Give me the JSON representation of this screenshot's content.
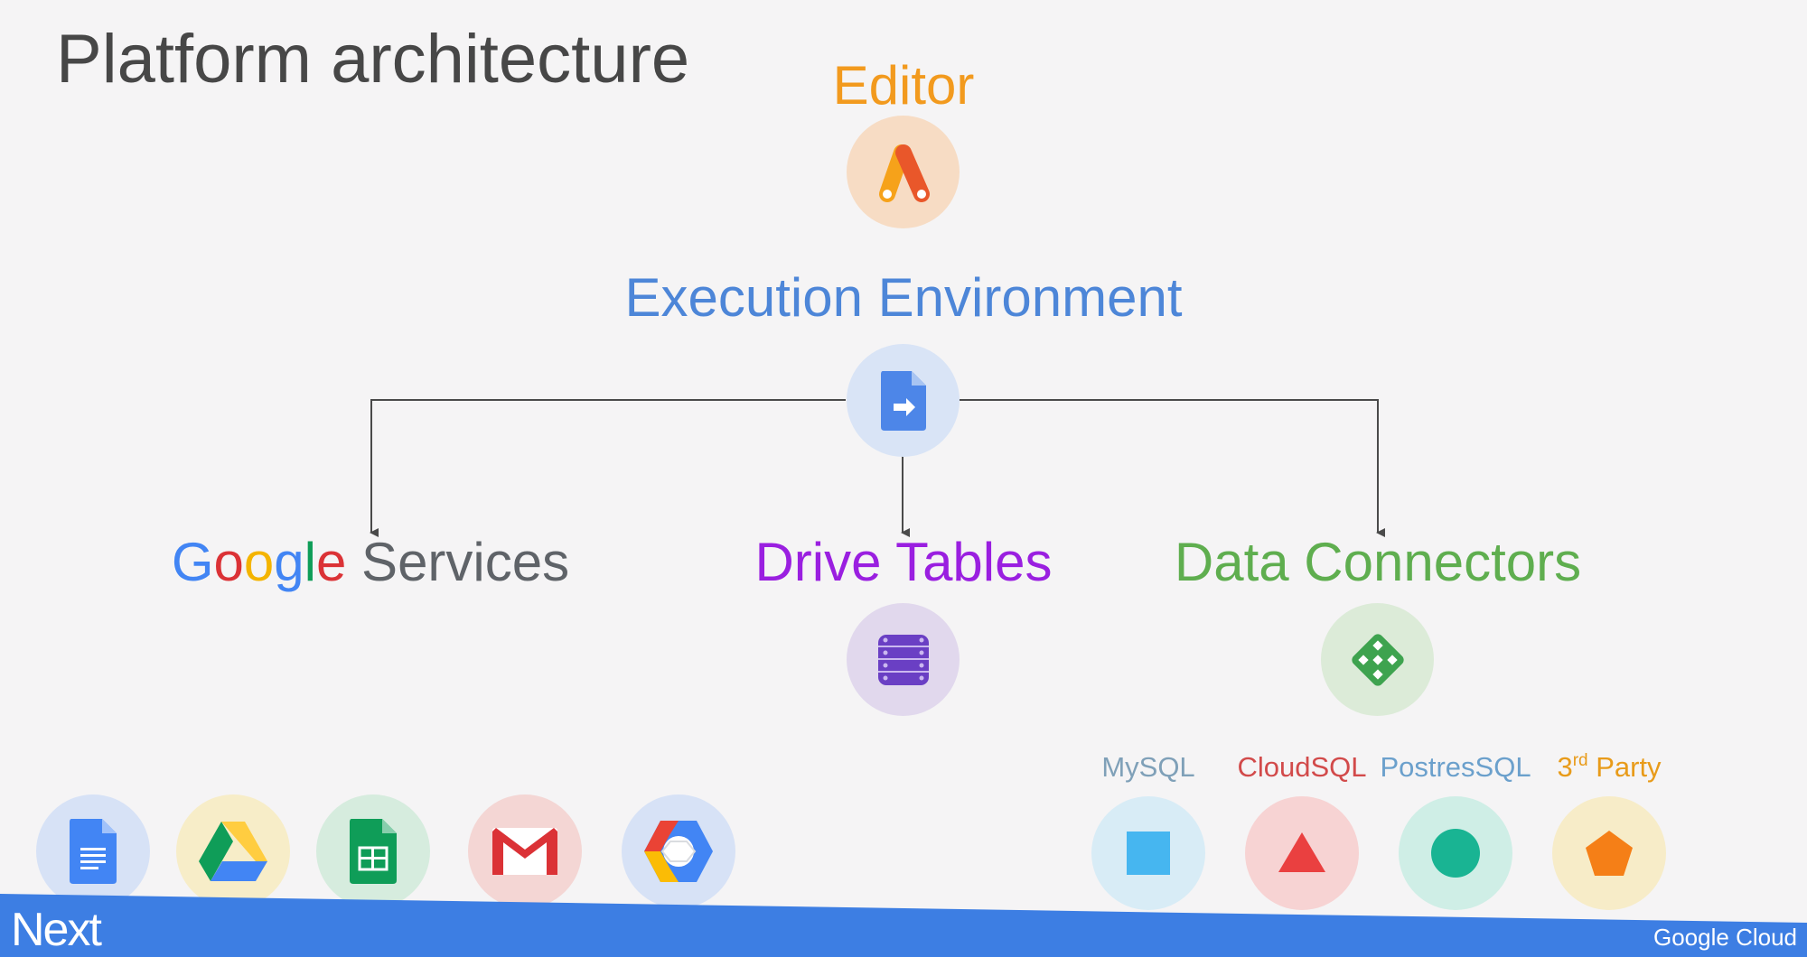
{
  "slide": {
    "title": "Platform architecture"
  },
  "nodes": {
    "editor": {
      "label": "Editor",
      "color": "#f29a1e",
      "icon": "apps-script-icon"
    },
    "execution": {
      "label": "Execution Environment",
      "color": "#4d86d8",
      "icon": "script-file-icon"
    },
    "google_services": {
      "brand_letters": [
        "G",
        "o",
        "o",
        "g",
        "l",
        "e"
      ],
      "label_suffix": " Services",
      "icon": "google-services"
    },
    "drive_tables": {
      "label": "Drive Tables",
      "color": "#9a1fe0",
      "icon": "drive-tables-icon"
    },
    "data_connectors": {
      "label": "Data Connectors",
      "color": "#5fae4f",
      "icon": "data-connector-icon"
    }
  },
  "google_apps": [
    {
      "name": "docs-icon",
      "bg": "#d7e2f6"
    },
    {
      "name": "drive-icon",
      "bg": "#f7edc8"
    },
    {
      "name": "sheets-icon",
      "bg": "#d6ecde"
    },
    {
      "name": "gmail-icon",
      "bg": "#f4d6d4"
    },
    {
      "name": "google-cloud-platform-icon",
      "bg": "#d7e2f6"
    }
  ],
  "databases": [
    {
      "label": "MySQL",
      "color": "#7fa0b8",
      "bg": "#d8ecf6",
      "shape": "square-icon"
    },
    {
      "label": "CloudSQL",
      "color": "#d24a4a",
      "bg": "#f7d3d3",
      "shape": "triangle-icon"
    },
    {
      "label": "PostresSQL",
      "color": "#6ba0cc",
      "bg": "#cfeee6",
      "shape": "circle-icon"
    },
    {
      "label_main": "3",
      "label_sup": "rd",
      "label_rest": " Party",
      "color": "#e89b1a",
      "bg": "#f7ecc8",
      "shape": "pentagon-icon"
    }
  ],
  "footer": {
    "event_logo": "Next",
    "brand_logo": "Google Cloud",
    "bar_color": "#3d7ee3"
  }
}
